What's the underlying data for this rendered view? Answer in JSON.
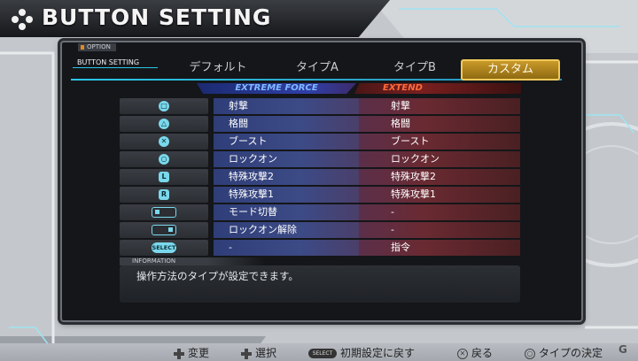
{
  "header": {
    "title": "BUTTON SETTING",
    "icon": "dpad-icon"
  },
  "panel": {
    "option_label": "OPTION",
    "section_label": "BUTTON SETTING",
    "tabs": [
      {
        "label": "デフォルト",
        "active": false
      },
      {
        "label": "タイプA",
        "active": false
      },
      {
        "label": "タイプB",
        "active": false
      },
      {
        "label": "カスタム",
        "active": true
      }
    ]
  },
  "columns": {
    "extreme_force": "EXTREME FORCE",
    "extend": "EXTEND"
  },
  "rows": [
    {
      "button": "square-icon",
      "glyph": "□",
      "ef": "射撃",
      "ex": "射撃"
    },
    {
      "button": "triangle-icon",
      "glyph": "△",
      "ef": "格闘",
      "ex": "格闘"
    },
    {
      "button": "cross-icon",
      "glyph": "✕",
      "ef": "ブースト",
      "ex": "ブースト"
    },
    {
      "button": "circle-icon",
      "glyph": "○",
      "ef": "ロックオン",
      "ex": "ロックオン"
    },
    {
      "button": "l-button-icon",
      "glyph": "L",
      "ef": "特殊攻撃2",
      "ex": "特殊攻撃2"
    },
    {
      "button": "r-button-icon",
      "glyph": "R",
      "ef": "特殊攻撃1",
      "ex": "特殊攻撃1"
    },
    {
      "button": "analog-left-icon",
      "glyph": "",
      "ef": "モード切替",
      "ex": "-"
    },
    {
      "button": "analog-right-icon",
      "glyph": "",
      "ef": "ロックオン解除",
      "ex": "-"
    },
    {
      "button": "select-button-icon",
      "glyph": "SELECT",
      "ef": "-",
      "ex": "指令"
    }
  ],
  "information": {
    "label": "INFORMATION",
    "text": "操作方法のタイプが設定できます。"
  },
  "footer": {
    "change": "変更",
    "select": "選択",
    "select_btn": "SELECT",
    "reset": "初期設定に戻す",
    "back": "戻る",
    "confirm": "タイプの決定"
  },
  "colors": {
    "accent": "#2ac6e8",
    "active_tab": "#c99a2a",
    "extreme_force": "#7fb8ff",
    "extend": "#ff6a3a"
  }
}
